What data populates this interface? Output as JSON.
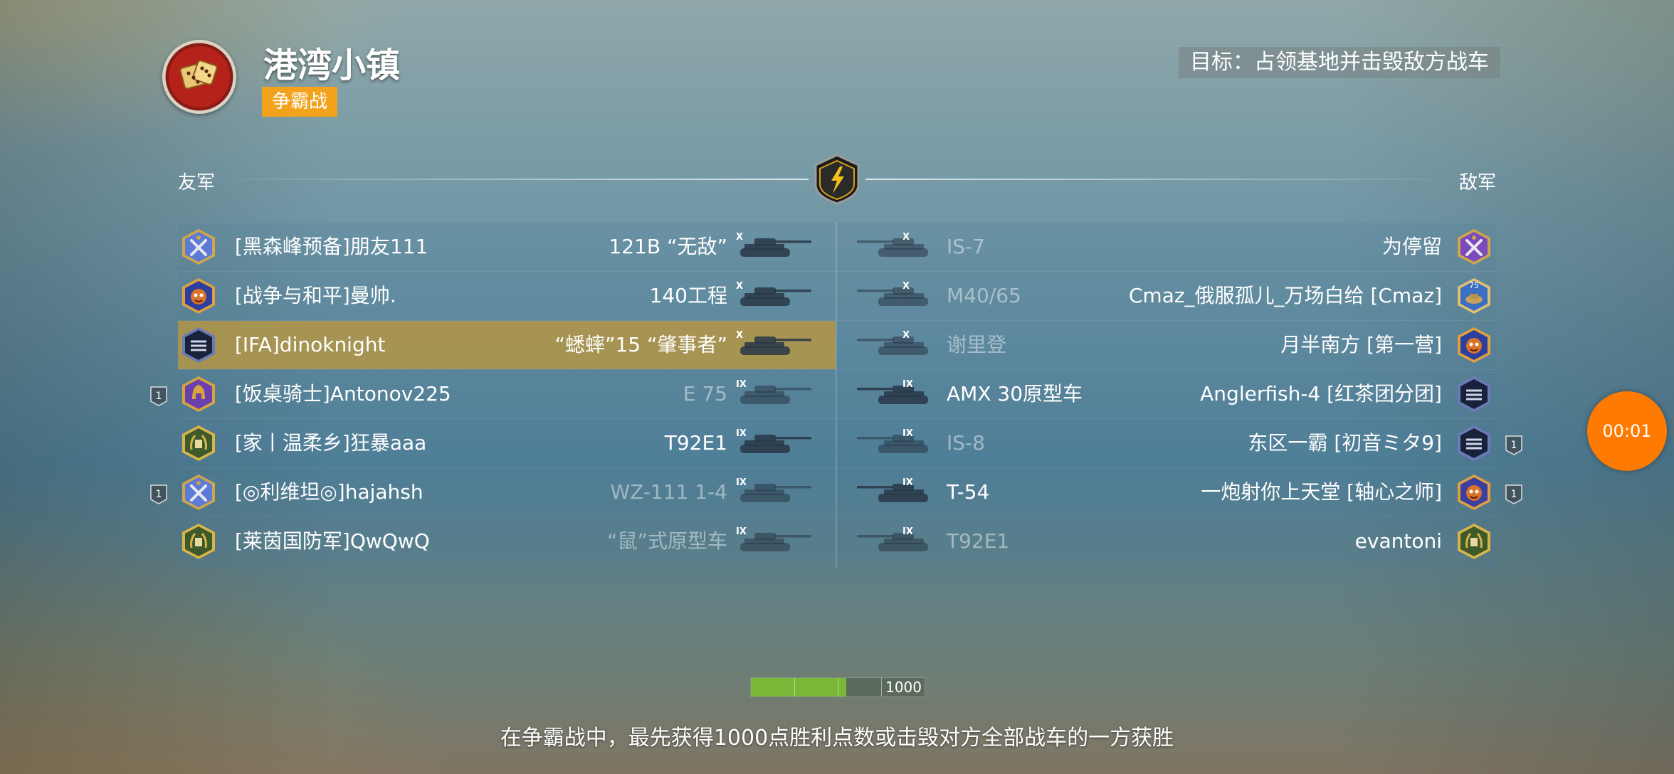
{
  "map": {
    "title": "港湾小镇",
    "mode": "争霸战",
    "icon": "dice-icon"
  },
  "objective": "目标：占领基地并击毁敌方战车",
  "teams": {
    "allies_label": "友军",
    "enemies_label": "敌军"
  },
  "allies": [
    {
      "player": "[黑森峰预备]朋友111",
      "tank": "121B “无敌”",
      "tier": "X",
      "platoon": "",
      "highlight": false,
      "dim": false,
      "avatar": "crossed-swords-badge-icon"
    },
    {
      "player": "[战争与和平]曼帅.",
      "tank": "140工程",
      "tier": "X",
      "platoon": "",
      "highlight": false,
      "dim": false,
      "avatar": "monkey-mascot-badge-icon"
    },
    {
      "player": "[IFA]dinoknight",
      "tank": "“蟋蟀”15 “肇事者”",
      "tier": "X",
      "platoon": "",
      "highlight": true,
      "dim": false,
      "avatar": "mad-games-badge-icon"
    },
    {
      "player": "[饭桌骑士]Antonov225",
      "tank": "E 75",
      "tier": "IX",
      "platoon": "1",
      "highlight": false,
      "dim": true,
      "avatar": "spartan-helmet-badge-icon"
    },
    {
      "player": "[家丨温柔乡]狂暴aaa",
      "tank": "T92E1",
      "tier": "IX",
      "platoon": "",
      "highlight": false,
      "dim": false,
      "avatar": "laurel-shield-badge-icon"
    },
    {
      "player": "[◎利维坦◎]hajahsh",
      "tank": "WZ-111 1-4",
      "tier": "IX",
      "platoon": "1",
      "highlight": false,
      "dim": true,
      "avatar": "crossed-swords-badge-icon"
    },
    {
      "player": "[莱茵国防军]QwQwQ",
      "tank": "“鼠”式原型车",
      "tier": "IX",
      "platoon": "",
      "highlight": false,
      "dim": true,
      "avatar": "laurel-shield-badge-icon"
    }
  ],
  "enemies": [
    {
      "player": "为停留",
      "tank": "IS-7",
      "tier": "X",
      "platoon": "",
      "dim": true,
      "avatar": "crossed-swords-purple-badge-icon"
    },
    {
      "player": "Cmaz_俄服孤儿_万场白给 [Cmaz]",
      "tank": "M40/65",
      "tier": "X",
      "platoon": "",
      "dim": true,
      "avatar": "anniversary-75-badge-icon",
      "avatar_text": "75"
    },
    {
      "player": "月半南方 [第一营]",
      "tank": "谢里登",
      "tier": "X",
      "platoon": "",
      "dim": true,
      "avatar": "monkey-mascot-badge-icon"
    },
    {
      "player": "Anglerfish-4 [红茶团分团]",
      "tank": "AMX 30原型车",
      "tier": "IX",
      "platoon": "",
      "dim": false,
      "avatar": "mad-games-badge-icon"
    },
    {
      "player": "东区一霸 [初音ミタ9]",
      "tank": "IS-8",
      "tier": "IX",
      "platoon": "1",
      "dim": true,
      "avatar": "mad-games-badge-icon"
    },
    {
      "player": "一炮射你上天堂 [轴心之师]",
      "tank": "T-54",
      "tier": "IX",
      "platoon": "1",
      "dim": false,
      "avatar": "cartoon-face-badge-icon"
    },
    {
      "player": "evantoni",
      "tank": "T92E1",
      "tier": "IX",
      "platoon": "",
      "dim": true,
      "avatar": "laurel-shield-badge-icon"
    }
  ],
  "score": {
    "value_label": "1000",
    "fill_fraction": 0.55
  },
  "hint": "在争霸战中，最先获得1000点胜利点数或击毁对方全部战车的一方获胜",
  "timer": "00:01",
  "colors": {
    "mode_badge": "#f2a21b",
    "highlight_row": "#b4964a",
    "score_fill": "#7ab83a",
    "timer": "#ff7a00"
  }
}
